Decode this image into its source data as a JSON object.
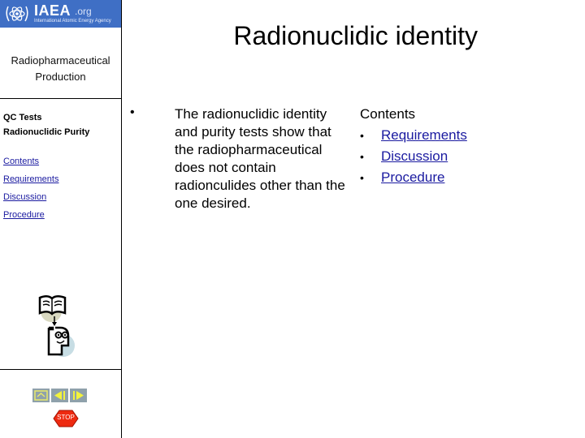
{
  "logo": {
    "name": "IAEA",
    "suffix": ".org",
    "tagline": "International Atomic Energy Agency"
  },
  "sidebar": {
    "subtitle_line1": "Radiopharmaceutical",
    "subtitle_line2": "Production",
    "section_line1": "QC Tests",
    "section_line2": "Radionuclidic Purity",
    "links": [
      {
        "label": "Contents"
      },
      {
        "label": "Requirements"
      },
      {
        "label": "Discussion"
      },
      {
        "label": "Procedure"
      }
    ],
    "nav": {
      "home_icon": "home-icon",
      "back_icon": "back-arrow-icon",
      "forward_icon": "forward-arrow-icon",
      "stop_label": "STOP"
    }
  },
  "main": {
    "title": "Radionuclidic identity",
    "bullet_char": "•",
    "bullet_text": "The radionuclidic identity and purity tests show that the radiopharmaceutical does not contain radionculides other than the one desired.",
    "contents": {
      "heading": "Contents",
      "items": [
        {
          "label": "Requirements"
        },
        {
          "label": "Discussion"
        },
        {
          "label": "Procedure"
        }
      ]
    }
  },
  "colors": {
    "logo_bg": "#3f6fc5",
    "link": "#1a1aa0",
    "nav_button": "#8fa1ab",
    "nav_arrow": "#f2f23c",
    "stop": "#ee2a10"
  }
}
